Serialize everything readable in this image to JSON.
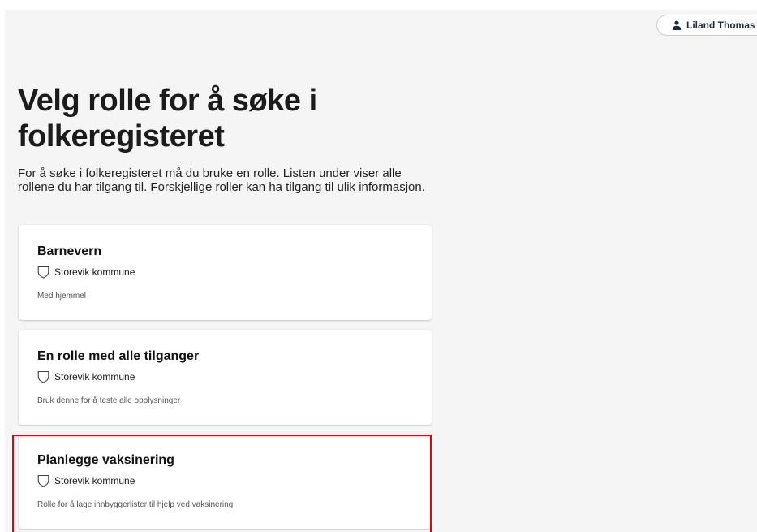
{
  "header": {
    "user_name": "Liland Thomas"
  },
  "main": {
    "title": "Velg rolle for å søke i folkeregisteret",
    "intro": "For å søke i folkeregisteret må du bruke en rolle. Listen under viser alle rollene du har tilgang til. Forskjellige roller kan ha tilgang til ulik informasjon.",
    "roles": [
      {
        "title": "Barnevern",
        "organization": "Storevik kommune",
        "description": "Med hjemmel"
      },
      {
        "title": "En rolle med alle tilganger",
        "organization": "Storevik kommune",
        "description": "Bruk denne for å teste alle opplysninger"
      },
      {
        "title": "Planlegge vaksinering",
        "organization": "Storevik kommune",
        "description": "Rolle for å lage innbyggerlister til hjelp ved vaksinering"
      }
    ]
  },
  "colors": {
    "background": "#f5f5f6",
    "card": "#ffffff",
    "highlight": "#e3000f",
    "user_text": "#1e2a44"
  },
  "icons": {
    "user": "person-icon",
    "organization": "shield-icon"
  }
}
